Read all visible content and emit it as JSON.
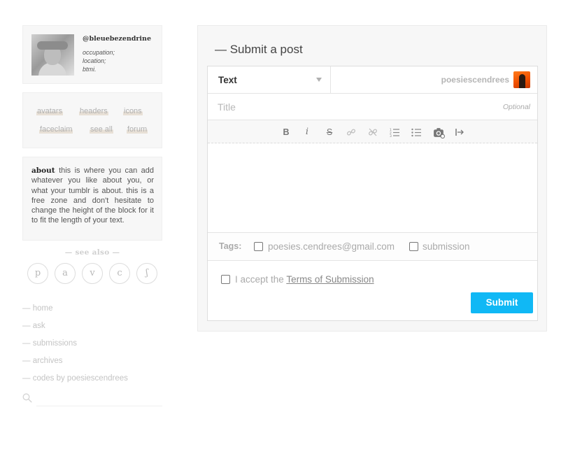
{
  "profile": {
    "handle": "@bleuebezendrine",
    "occupation": "occupation;",
    "location": "location;",
    "btmi": "btmi."
  },
  "tag_links": [
    "avatars",
    "headers",
    "icons",
    "faceclaim",
    "see all",
    "forum"
  ],
  "about": {
    "label": "about",
    "text": "this is where you can add whatever you like about you, or what your tumblr is about. this is a free zone and don't hesitate to change the height of the block for it to fit the length of your text."
  },
  "see_also": {
    "title": "— see also —",
    "links": [
      "p",
      "a",
      "v",
      "c",
      "ʃ"
    ]
  },
  "nav": {
    "items": [
      "— home",
      "— ask",
      "— submissions",
      "— archives",
      "— codes by poesiescendrees"
    ],
    "search_icon": "search-icon"
  },
  "submit": {
    "title": "— Submit a post",
    "post_type": "Text",
    "blog_name": "poesiescendrees",
    "title_placeholder": "Title",
    "optional_label": "Optional",
    "toolbar_icons": [
      "bold-icon",
      "italic-icon",
      "strikethrough-icon",
      "link-icon",
      "unlink-icon",
      "ordered-list-icon",
      "unordered-list-icon",
      "camera-icon",
      "read-more-icon"
    ],
    "tags_label": "Tags:",
    "tag_options": [
      "poesies.cendrees@gmail.com",
      "submission"
    ],
    "accept_prefix": "I accept the",
    "terms_link": "Terms of Submission",
    "submit_label": "Submit"
  },
  "colors": {
    "accent": "#10b8f5",
    "panel_bg": "#f7f7f7",
    "tag_underline": "#e8e0d6"
  }
}
